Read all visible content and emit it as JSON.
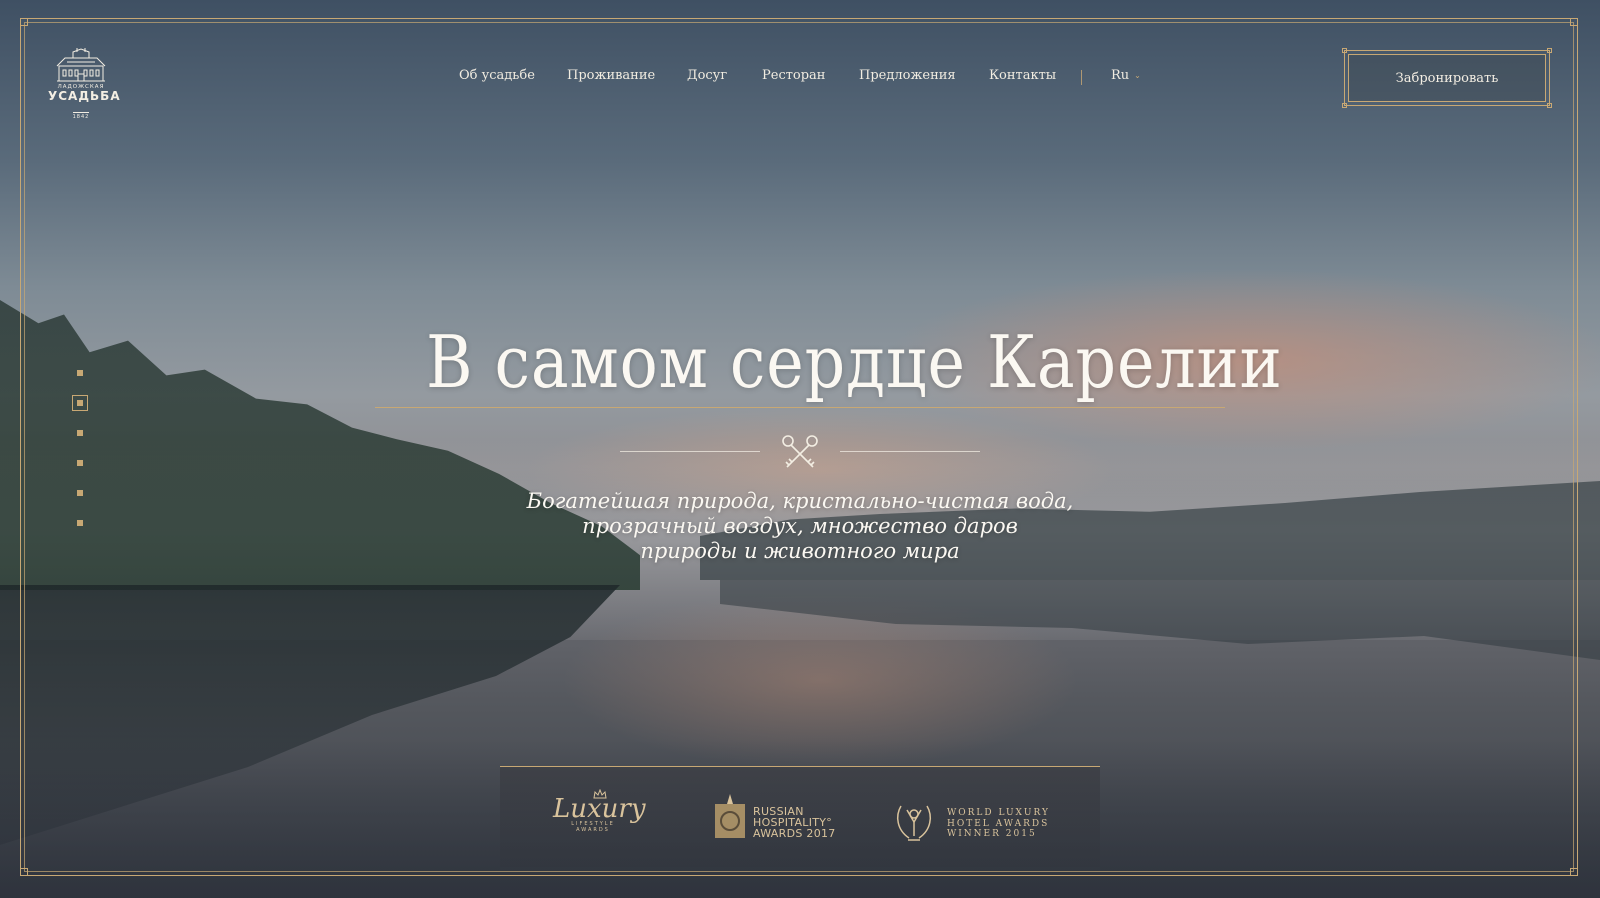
{
  "logo": {
    "line1": "ЛАДОЖСКАЯ",
    "line2": "УСАДЬБА",
    "line3": "1842"
  },
  "nav": {
    "items": [
      {
        "label": "Об усадьбе"
      },
      {
        "label": "Проживание"
      },
      {
        "label": "Досуг"
      },
      {
        "label": "Ресторан"
      },
      {
        "label": "Предложения"
      },
      {
        "label": "Контакты"
      }
    ],
    "language": "Ru"
  },
  "book_button": {
    "label": "Забронировать"
  },
  "hero": {
    "headline": "В самом сердце Карелии",
    "subtitle_line1": "Богатейшая природа, кристально-чистая вода,",
    "subtitle_line2": "прозрачный воздух, множество даров",
    "subtitle_line3": "природы и животного мира"
  },
  "slider": {
    "count": 6,
    "active_index": 1
  },
  "awards": {
    "luxury_main": "Luxury",
    "luxury_small": "LIFESTYLE AWARDS",
    "rha_line1": "RUSSIAN",
    "rha_line2": "HOSPITALITY°",
    "rha_line3": "AWARDS 2017",
    "wl_line1": "WORLD LUXURY",
    "wl_line2": "HOTEL AWARDS",
    "wl_line3": "WINNER 2015"
  },
  "colors": {
    "accent_gold": "#c8a874",
    "text_light": "#f3eee3"
  }
}
